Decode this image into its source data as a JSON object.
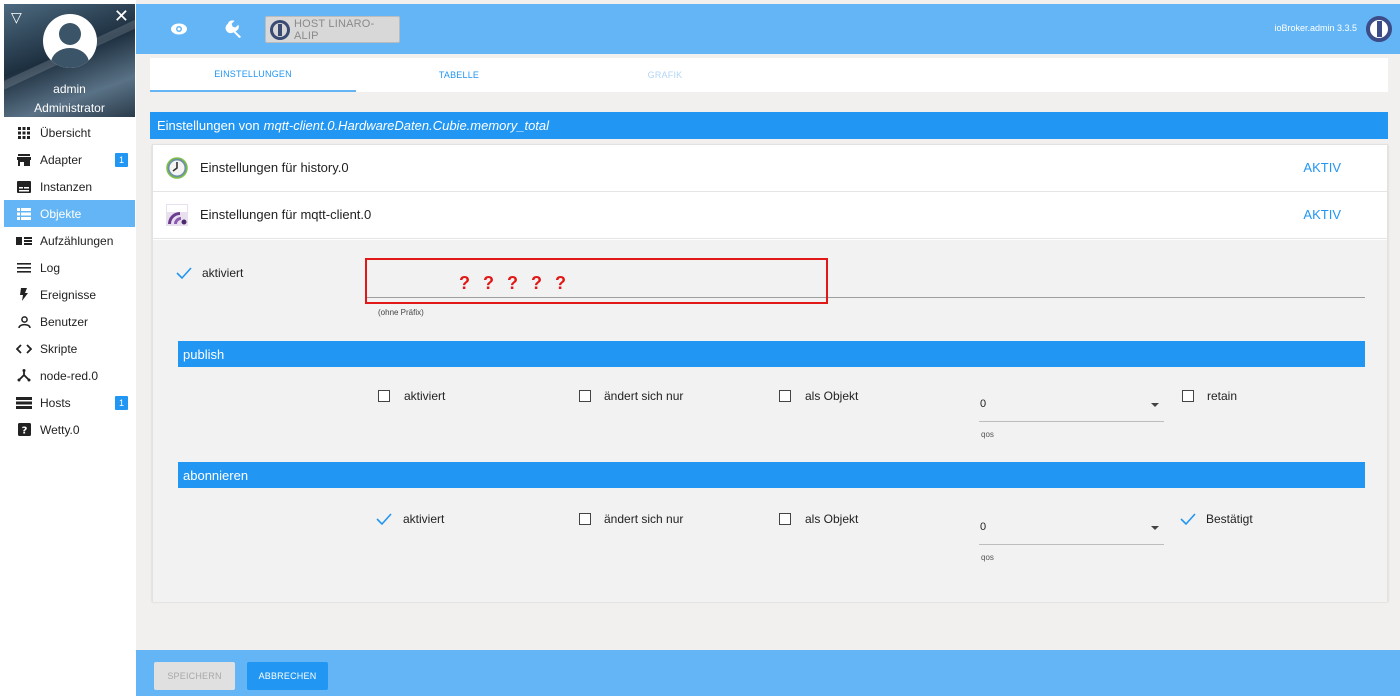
{
  "user": {
    "name": "admin",
    "role": "Administrator"
  },
  "sidebar": {
    "items": [
      {
        "label": "Übersicht",
        "icon": "grid-icon"
      },
      {
        "label": "Adapter",
        "icon": "store-icon",
        "badge": "1"
      },
      {
        "label": "Instanzen",
        "icon": "instances-icon"
      },
      {
        "label": "Objekte",
        "icon": "list-icon",
        "active": true
      },
      {
        "label": "Aufzählungen",
        "icon": "enum-icon"
      },
      {
        "label": "Log",
        "icon": "log-icon"
      },
      {
        "label": "Ereignisse",
        "icon": "bolt-icon"
      },
      {
        "label": "Benutzer",
        "icon": "user-icon"
      },
      {
        "label": "Skripte",
        "icon": "code-icon"
      },
      {
        "label": "node-red.0",
        "icon": "nodered-icon"
      },
      {
        "label": "Hosts",
        "icon": "hosts-icon",
        "badge": "1"
      },
      {
        "label": "Wetty.0",
        "icon": "help-icon"
      }
    ]
  },
  "topbar": {
    "host_label": "HOST LINARO-ALIP",
    "version": "ioBroker.admin 3.3.5"
  },
  "tabs": [
    "EINSTELLUNGEN",
    "TABELLE",
    "GRAFIK"
  ],
  "settings": {
    "prefix": "Einstellungen von",
    "object_id": "mqtt-client.0.HardwareDaten.Cubie.memory_total"
  },
  "adapters": [
    {
      "title": "Einstellungen für history.0",
      "status": "AKTIV"
    },
    {
      "title": "Einstellungen für mqtt-client.0",
      "status": "AKTIV"
    }
  ],
  "mqtt": {
    "enabled_label": "aktiviert",
    "prefix_value": "",
    "prefix_hint": "(ohne Präfix)",
    "annotation": "? ? ? ? ?",
    "publish": {
      "title": "publish",
      "enabled_label": "aktiviert",
      "changes_only_label": "ändert sich nur",
      "as_object_label": "als Objekt",
      "qos_value": "0",
      "qos_label": "qos",
      "retain_label": "retain"
    },
    "subscribe": {
      "title": "abonnieren",
      "enabled_label": "aktiviert",
      "changes_only_label": "ändert sich nur",
      "as_object_label": "als Objekt",
      "qos_value": "0",
      "qos_label": "qos",
      "ack_label": "Bestätigt"
    }
  },
  "buttons": {
    "save": "SPEICHERN",
    "cancel": "ABBRECHEN"
  },
  "colors": {
    "accent": "#2196f3",
    "bar": "#64b5f6",
    "annotation": "#e01818"
  }
}
